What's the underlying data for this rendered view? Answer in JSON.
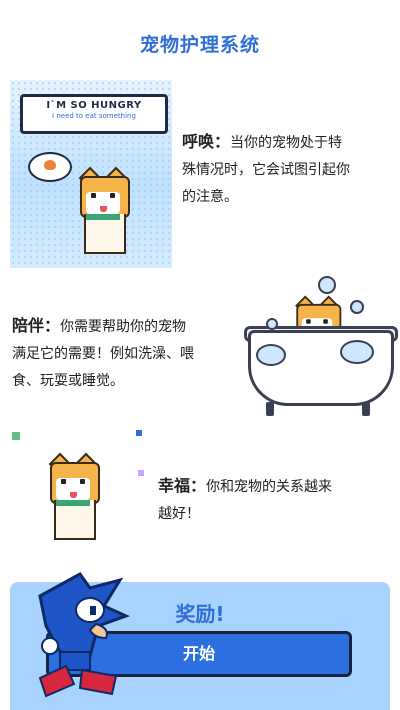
{
  "header": {
    "title": "宠物护理系统"
  },
  "feature1": {
    "bubble_title": "I`M SO HUNGRY",
    "bubble_subtitle": "I need to eat something",
    "heading": "呼唤",
    "separator": "：",
    "line1": "当你的宠物处于特",
    "line2": "殊情况时，它会试图引起你",
    "line3": "的注意。"
  },
  "feature2": {
    "heading": "陪伴",
    "separator": "：",
    "line1": "你需要帮助你的宠物",
    "line2": "满足它的需要！例如洗澡、喂",
    "line3": "食、玩耍或睡觉。"
  },
  "feature3": {
    "heading": "幸福",
    "separator": "：",
    "line1": "你和宠物的关系越来",
    "line2": "越好！"
  },
  "reward": {
    "title": "奖励!",
    "start_label": "开始"
  },
  "colors": {
    "accent": "#2f6fd6",
    "button": "#2b6fe0",
    "banner": "#a9d3ff"
  }
}
